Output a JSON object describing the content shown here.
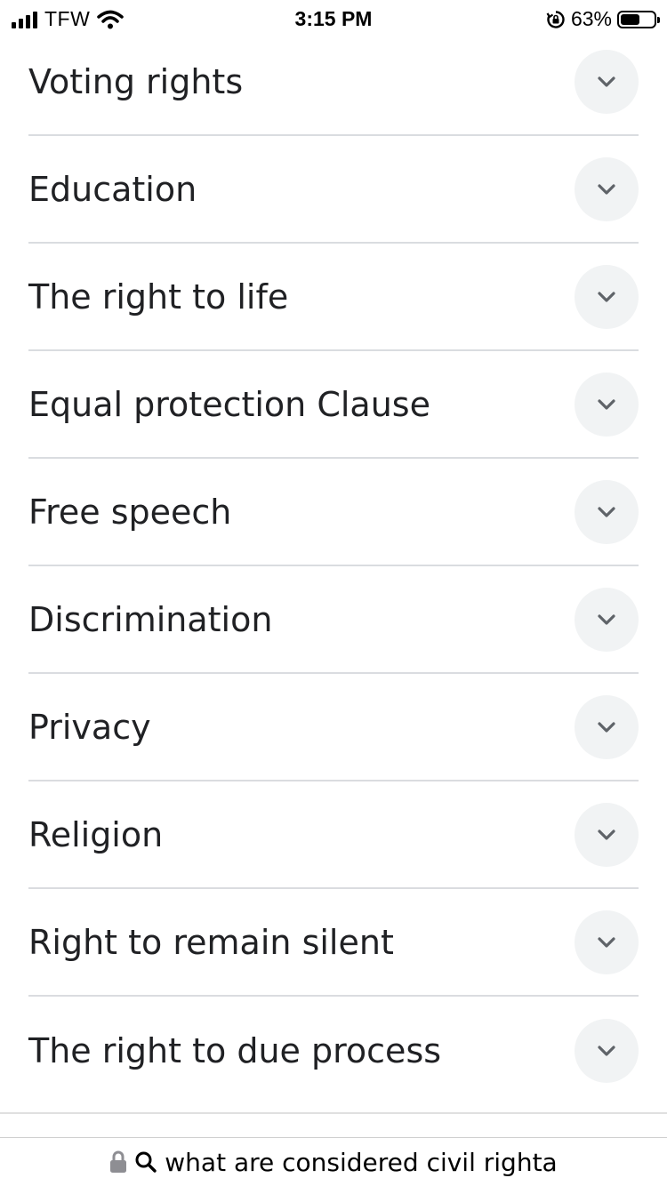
{
  "status_bar": {
    "carrier": "TFW",
    "time": "3:15 PM",
    "battery_percent": "63%",
    "battery_level": 0.63
  },
  "topics": [
    {
      "label": "Voting rights"
    },
    {
      "label": "Education"
    },
    {
      "label": "The right to life"
    },
    {
      "label": "Equal protection Clause"
    },
    {
      "label": "Free speech"
    },
    {
      "label": "Discrimination"
    },
    {
      "label": "Privacy"
    },
    {
      "label": "Religion"
    },
    {
      "label": "Right to remain silent"
    },
    {
      "label": "The right to due process"
    }
  ],
  "address_bar": {
    "query": "what are considered civil righta",
    "icons": [
      "lock-icon",
      "search-icon"
    ]
  },
  "colors": {
    "text": "#202124",
    "divider": "#dadce0",
    "button_bg": "#f1f3f4",
    "chevron": "#5f6368"
  }
}
